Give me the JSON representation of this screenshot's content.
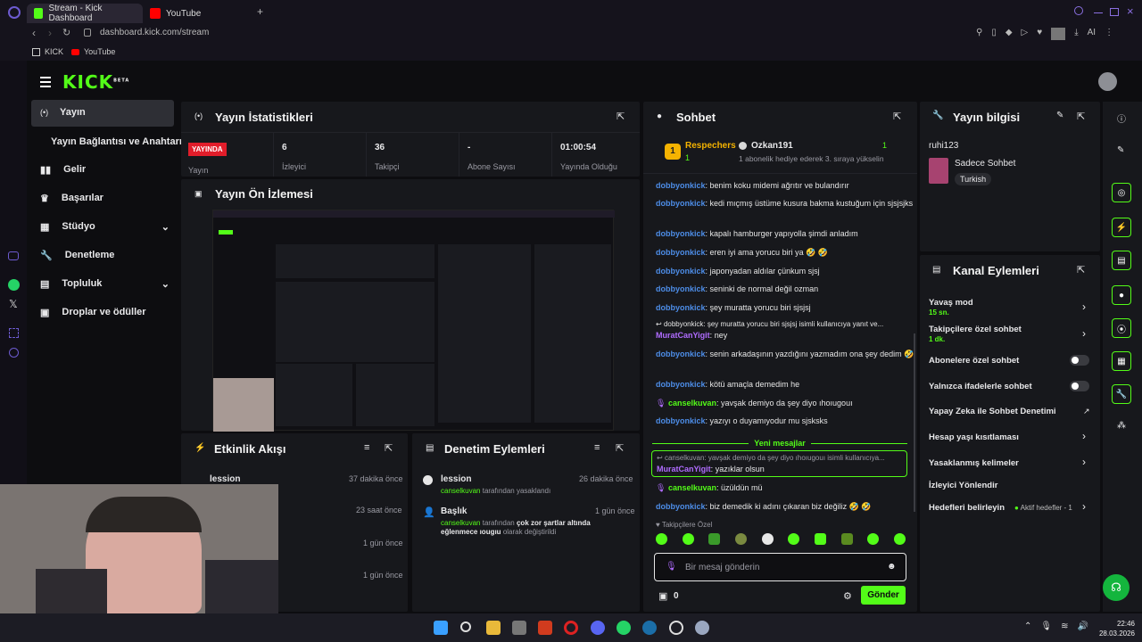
{
  "browser": {
    "tabs": [
      {
        "label": "Stream - Kick Dashboard",
        "active": true
      },
      {
        "label": "YouTube",
        "active": false
      }
    ],
    "url": "dashboard.kick.com/stream",
    "ai_label": "AI",
    "bookmarks": [
      "KICK",
      "YouTube"
    ]
  },
  "kick": {
    "logo": "KICK",
    "logo_badge": "BETA"
  },
  "sidebar": {
    "items": [
      {
        "label": "Yayın",
        "icon": "broadcast-icon",
        "active": true
      },
      {
        "label": "Yayın Bağlantısı ve Anahtarı",
        "icon": "",
        "sub": true
      },
      {
        "label": "Gelir",
        "icon": "chart-icon"
      },
      {
        "label": "Başarılar",
        "icon": "trophy-icon"
      },
      {
        "label": "Stüdyo",
        "icon": "studio-icon",
        "expandable": true
      },
      {
        "label": "Denetleme",
        "icon": "wrench-icon"
      },
      {
        "label": "Topluluk",
        "icon": "community-icon",
        "expandable": true
      },
      {
        "label": "Droplar ve ödüller",
        "icon": "gift-icon"
      }
    ]
  },
  "stats": {
    "title": "Yayın İstatistikleri",
    "live_badge": "YAYINDA",
    "live_label": "Yayın",
    "items": [
      {
        "value": "6",
        "label": "İzleyici"
      },
      {
        "value": "36",
        "label": "Takipçi"
      },
      {
        "value": "-",
        "label": "Abone Sayısı"
      },
      {
        "value": "01:00:54",
        "label": "Yayında Olduğu"
      }
    ]
  },
  "preview": {
    "title": "Yayın Ön İzlemesi"
  },
  "activity": {
    "title": "Etkinlik Akışı",
    "items": [
      {
        "name": "lession",
        "time": "37 dakika önce"
      },
      {
        "name": "",
        "time": "23 saat önce"
      },
      {
        "name": "",
        "time": "1 gün önce"
      },
      {
        "name": "",
        "time": "1 gün önce"
      }
    ]
  },
  "mod_actions": {
    "title": "Denetim Eylemleri",
    "items": [
      {
        "target": "lession",
        "actor": "canselkuvan",
        "text": "tarafından yasaklandı",
        "time": "26 dakika önce"
      },
      {
        "target": "Başlık",
        "actor": "canselkuvan",
        "text1": "tarafından",
        "bold": "çok zor şartlar altında eğlenmece ıougıu",
        "text2": "olarak değiştirildi",
        "time": "1 gün önce"
      }
    ]
  },
  "chat": {
    "title": "Sohbet",
    "gift_rank_label": "Respechers",
    "gift_rank_count": "1",
    "gifter_name": "Ozkan191",
    "gifter_count": "1",
    "gift_notice": "1 abonelik hediye ederek 3. sıraya yükselin",
    "messages": [
      {
        "user": "dobbyonkick",
        "text": "benim koku midemi ağrıtır ve bulandırır"
      },
      {
        "user": "dobbyonkick",
        "text": "kedi mıçmış üstüme kusura bakma kustuğum için sjsjsjks"
      },
      {
        "user": "dobbyonkick",
        "text": "kapalı hamburger yapıyolla şimdi anladım"
      },
      {
        "user": "dobbyonkick",
        "text": "eren iyi ama yorucu biri ya 🤣 🤣"
      },
      {
        "user": "dobbyonkick",
        "text": "japonyadan aldılar çünkum sjsj"
      },
      {
        "user": "dobbyonkick",
        "text": "seninki de normal değil ozman"
      },
      {
        "user": "dobbyonkick",
        "text": "şey muratta yorucu biri sjsjsj"
      }
    ],
    "reply_preview": "dobbyonkick: şey muratta yorucu biri sjsjsj isimli kullanıcıya yanıt ve...",
    "reply_user": "MuratCanYigit",
    "reply_text": "ney",
    "messages2": [
      {
        "user": "dobbyonkick",
        "text": "senin arkadaşının yazdığını yazmadım ona şey dedim 🤣"
      },
      {
        "user": "dobbyonkick",
        "text": "kötü amaçla demedim he"
      },
      {
        "user": "canselkuvan",
        "text": "yavşak demiyo da şey diyo ıhoıugouı",
        "mic": true
      },
      {
        "user": "dobbyonkick",
        "text": "yazıyı o duyamıyodur mu sjsksks"
      }
    ],
    "new_messages": "Yeni mesajlar",
    "highlight_reply": "canselkuvan: yavşak demiyo da şey diyo ıhoıugouı isimli kullanıcıya...",
    "highlight_user": "MuratCanYigit",
    "highlight_text": "yazıklar olsun",
    "messages3": [
      {
        "user": "canselkuvan",
        "text": "üzüldün mü",
        "mic": true
      },
      {
        "user": "dobbyonkick",
        "text": "biz demedik ki adını çıkaran biz değiliz 🤣 🤣"
      }
    ],
    "followers_only": "Takipçilere Özel",
    "input_placeholder": "Bir mesaj gönderin",
    "points": "0",
    "send_label": "Gönder"
  },
  "stream_info": {
    "title": "Yayın bilgisi",
    "stream_title": "ruhi123",
    "category": "Sadece Sohbet",
    "tag": "Turkish"
  },
  "channel_actions": {
    "title": "Kanal Eylemleri",
    "items": [
      {
        "label": "Yavaş mod",
        "sub": "15 sn.",
        "control": "chevron"
      },
      {
        "label": "Takipçilere özel sohbet",
        "sub": "1 dk.",
        "control": "chevron"
      },
      {
        "label": "Abonelere özel sohbet",
        "sub": "",
        "control": "toggle"
      },
      {
        "label": "Yalnızca ifadelerle sohbet",
        "sub": "",
        "control": "toggle"
      },
      {
        "label": "Yapay Zeka ile Sohbet Denetimi",
        "sub": "",
        "control": "external"
      },
      {
        "label": "Hesap yaşı kısıtlaması",
        "sub": "",
        "control": "chevron"
      },
      {
        "label": "Yasaklanmış kelimeler",
        "sub": "",
        "control": "chevron"
      },
      {
        "label": "İzleyici Yönlendir",
        "sub": "",
        "control": "none"
      },
      {
        "label": "Hedefleri belirleyin",
        "sub": "",
        "control": "chevron",
        "extra": "Aktif hedefler - 1"
      }
    ]
  },
  "taskbar": {
    "time": "22:46",
    "date": "28.03.2026"
  },
  "colors": {
    "accent": "#53fc18",
    "panel": "#17181c",
    "username": "#4d8de8",
    "live": "#e11d2a"
  }
}
